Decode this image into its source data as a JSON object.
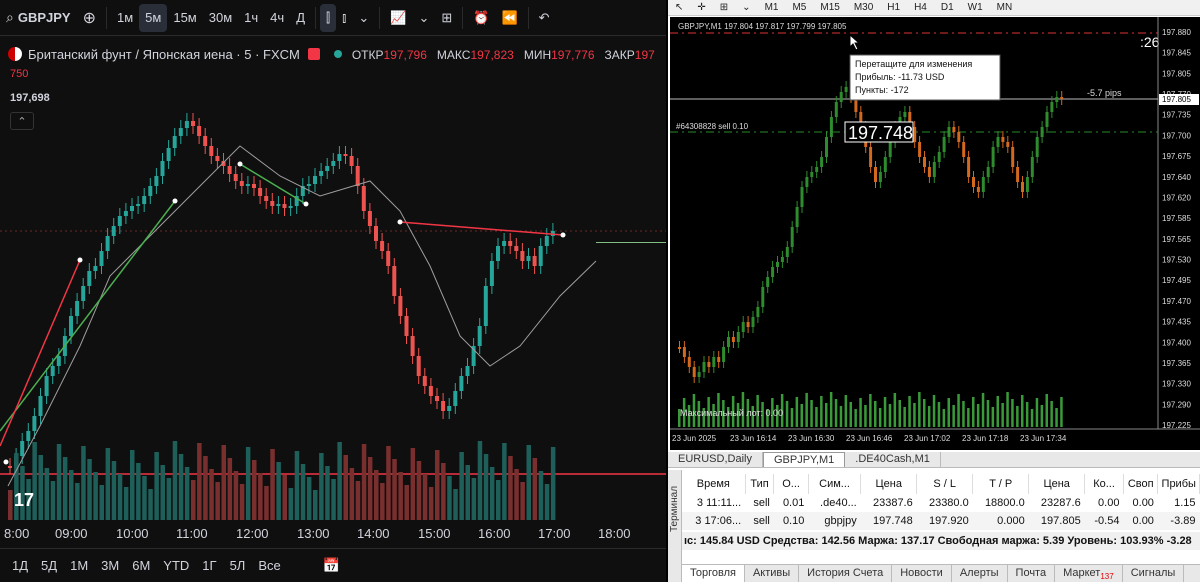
{
  "tv": {
    "symbol": "GBPJPY",
    "timeframes": [
      "1м",
      "5м",
      "15м",
      "30м",
      "1ч",
      "4ч",
      "Д"
    ],
    "active_timeframe": "5м",
    "instrument_title": "Британский фунт / Японская иена · 5 · FXCM",
    "ohlc": [
      {
        "label": "ОТКР",
        "value": "197,796"
      },
      {
        "label": "МАКС",
        "value": "197,823"
      },
      {
        "label": "МИН",
        "value": "197,776"
      },
      {
        "label": "ЗАКР",
        "value": "197"
      }
    ],
    "extra_value": "750",
    "current_price": "197,698",
    "time_labels": [
      "8:00",
      "09:00",
      "10:00",
      "11:00",
      "12:00",
      "13:00",
      "14:00",
      "15:00",
      "16:00",
      "17:00",
      "18:00"
    ],
    "ranges": [
      "1Д",
      "5Д",
      "1М",
      "3М",
      "6М",
      "YTD",
      "1Г",
      "5Л",
      "Все"
    ],
    "colors": {
      "up": "#26a69a",
      "down": "#ef5350",
      "trend_green": "#4caf50",
      "trend_red": "#f23645"
    }
  },
  "mt": {
    "timeframes": [
      "M1",
      "M5",
      "M15",
      "M30",
      "H1",
      "H4",
      "D1",
      "W1",
      "MN"
    ],
    "chart_header": "GBPJPY,M1  197.804 197.817 197.799 197.805",
    "countdown": ":26",
    "tooltip": {
      "line1": "Перетащите для изменения",
      "line2": "Прибыль: -11.73 USD",
      "line3": "Пункты: -172"
    },
    "pips_label": "-5.7 pips",
    "order_label": "#64308828 sell 0.10",
    "order_price": "197.748",
    "bid_tag": "197.805",
    "max_lot": "Максимальный лот: 0.00",
    "price_labels": [
      "197.880",
      "197.845",
      "197.805",
      "197.770",
      "197.735",
      "197.700",
      "197.675",
      "197.640",
      "197.620",
      "197.585",
      "197.565",
      "197.530",
      "197.495",
      "197.470",
      "197.435",
      "197.400",
      "197.365",
      "197.330",
      "197.290",
      "197.225"
    ],
    "time_labels": [
      "23 Jun 2025",
      "23 Jun 16:14",
      "23 Jun 16:30",
      "23 Jun 16:46",
      "23 Jun 17:02",
      "23 Jun 17:18",
      "23 Jun 17:34"
    ],
    "chart_tabs": [
      "EURUSD,Daily",
      "GBPJPY,M1",
      ".DE40Cash,M1"
    ],
    "active_chart_tab": "GBPJPY,M1",
    "table_headers": [
      "Время",
      "Тип",
      "О...",
      "Сим...",
      "Цена",
      "S / L",
      "T / P",
      "Цена",
      "Ко...",
      "Своп",
      "Прибы"
    ],
    "table_rows": [
      [
        "3 11:11...",
        "sell",
        "0.01",
        ".de40...",
        "23387.6",
        "23380.0",
        "18800.0",
        "23287.6",
        "0.00",
        "0.00",
        "1.15"
      ],
      [
        "3 17:06...",
        "sell",
        "0.10",
        "gbpjpy",
        "197.748",
        "197.920",
        "0.000",
        "197.805",
        "-0.54",
        "0.00",
        "-3.89"
      ]
    ],
    "summary": "ıс: 145.84 USD  Средства: 142.56  Маржа: 137.17  Свободная маржа: 5.39  Уровень: 103.93%  -3.28",
    "side_label": "Терминал",
    "bottom_tabs": [
      "Торговля",
      "Активы",
      "История Счета",
      "Новости",
      "Алерты",
      "Почта",
      "Маркет",
      "Сигналы"
    ],
    "market_badge": "137"
  }
}
